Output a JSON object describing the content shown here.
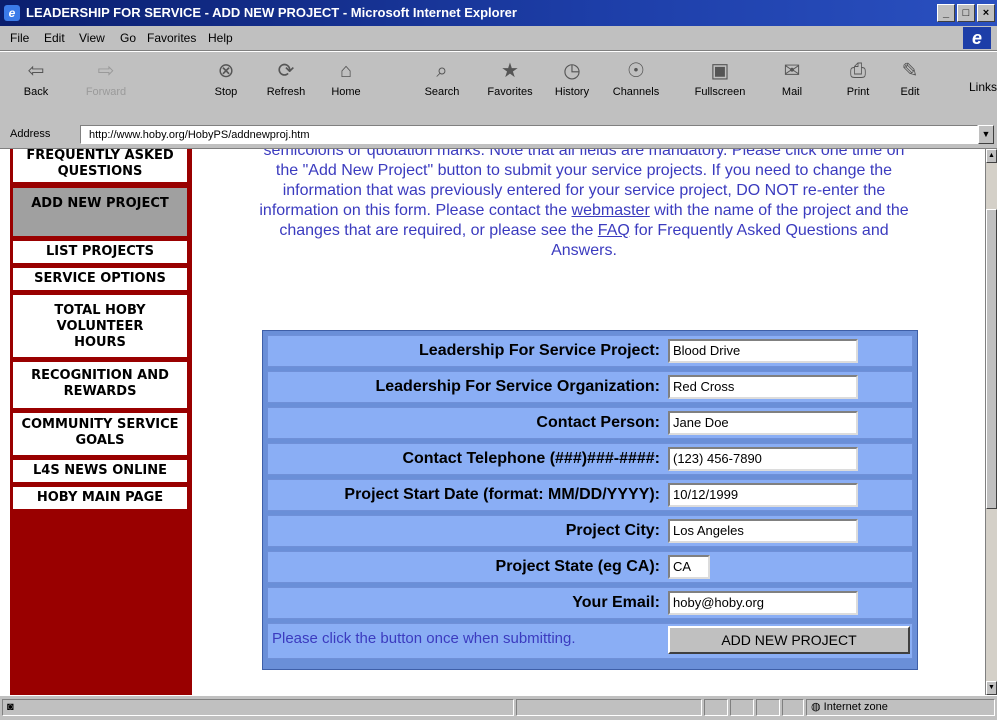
{
  "window": {
    "title": "LEADERSHIP FOR SERVICE - ADD NEW PROJECT - Microsoft Internet Explorer",
    "buttons": [
      "_",
      "□",
      "×"
    ]
  },
  "menu": [
    "File",
    "Edit",
    "View",
    "Go",
    "Favorites",
    "Help"
  ],
  "toolbar": {
    "buttons": [
      {
        "label": "Back",
        "icon": "⇦"
      },
      {
        "label": "Forward",
        "icon": "⇨"
      },
      {
        "label": "Stop",
        "icon": "⊗"
      },
      {
        "label": "Refresh",
        "icon": "⟳"
      },
      {
        "label": "Home",
        "icon": "⌂"
      },
      {
        "label": "Search",
        "icon": "⌕"
      },
      {
        "label": "Favorites",
        "icon": "★"
      },
      {
        "label": "History",
        "icon": "◷"
      },
      {
        "label": "Channels",
        "icon": "☉"
      },
      {
        "label": "Fullscreen",
        "icon": "▣"
      },
      {
        "label": "Mail",
        "icon": "✉"
      },
      {
        "label": "Print",
        "icon": "⎙"
      },
      {
        "label": "Edit",
        "icon": "✎"
      }
    ],
    "links_label": "Links"
  },
  "address": {
    "label": "Address",
    "url": "http://www.hoby.org/HobyPS/addnewproj.htm"
  },
  "sidebar": {
    "items": [
      {
        "label": "FREQUENTLY ASKED QUESTIONS"
      },
      {
        "label": "ADD NEW PROJECT"
      },
      {
        "label": "LIST PROJECTS"
      },
      {
        "label": "SERVICE OPTIONS"
      },
      {
        "label": "TOTAL HOBY VOLUNTEER HOURS"
      },
      {
        "label": "RECOGNITION AND REWARDS"
      },
      {
        "label": "COMMUNITY SERVICE GOALS"
      },
      {
        "label": "L4S NEWS ONLINE"
      },
      {
        "label": "HOBY MAIN PAGE"
      }
    ]
  },
  "intro": {
    "line1": "semicolons or quotation marks. Note that all fields are mandatory. Please click one time on",
    "line2": "the \"Add New Project\" button to submit your service projects. If you need to change the",
    "line3": "information that was previously entered for your service project, DO NOT re-enter the",
    "line4a": "information on this form. Please contact the ",
    "webmaster_link": "webmaster",
    "line4b": " with the name of the project and the",
    "line5a": "changes that are required, or please see the ",
    "faq_link": "FAQ",
    "line5b": " for Frequently Asked Questions and",
    "line6": "Answers."
  },
  "form": {
    "fields": [
      {
        "label": "Leadership For Service Project:",
        "value": "Blood Drive"
      },
      {
        "label": "Leadership For Service Organization:",
        "value": "Red Cross"
      },
      {
        "label": "Contact Person:",
        "value": "Jane Doe"
      },
      {
        "label": "Contact Telephone (###)###-####:",
        "value": "(123) 456-7890"
      },
      {
        "label": "Project Start Date (format: MM/DD/YYYY):",
        "value": "10/12/1999"
      },
      {
        "label": "Project City:",
        "value": "Los Angeles"
      },
      {
        "label": "Project State (eg CA):",
        "value": "CA"
      },
      {
        "label": "Your Email:",
        "value": "hoby@hoby.org"
      }
    ],
    "submit_note": "Please click the button once when submitting.",
    "submit_label": "ADD NEW PROJECT"
  },
  "status": {
    "zone": "Internet zone"
  }
}
